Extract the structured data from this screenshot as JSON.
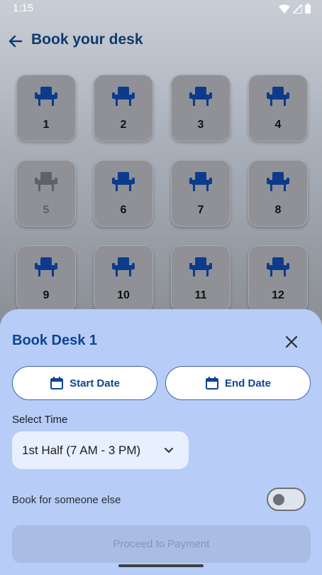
{
  "status_bar": {
    "time": "1:15"
  },
  "app_bar": {
    "title": "Book your desk"
  },
  "desks": [
    {
      "number": "1",
      "available": true
    },
    {
      "number": "2",
      "available": true
    },
    {
      "number": "3",
      "available": true
    },
    {
      "number": "4",
      "available": true
    },
    {
      "number": "5",
      "available": false
    },
    {
      "number": "6",
      "available": true
    },
    {
      "number": "7",
      "available": true
    },
    {
      "number": "8",
      "available": true
    },
    {
      "number": "9",
      "available": true
    },
    {
      "number": "10",
      "available": true
    },
    {
      "number": "11",
      "available": true
    },
    {
      "number": "12",
      "available": true
    }
  ],
  "sheet": {
    "title": "Book Desk 1",
    "start_date_label": "Start Date",
    "end_date_label": "End Date",
    "select_time_label": "Select Time",
    "selected_time": "1st Half (7 AM - 3 PM)",
    "book_someone_label": "Book for someone else",
    "book_someone_enabled": false,
    "proceed_label": "Proceed to Payment"
  },
  "colors": {
    "accent": "#0f4490",
    "chair": "#0d3b8c",
    "chair_unavailable": "#5f6166",
    "sheet_background": "#b7cdf7"
  },
  "icons": {
    "back": "arrow-left-icon",
    "chair": "chair-icon",
    "calendar": "calendar-icon",
    "close": "close-icon",
    "chevron": "chevron-down-icon"
  }
}
